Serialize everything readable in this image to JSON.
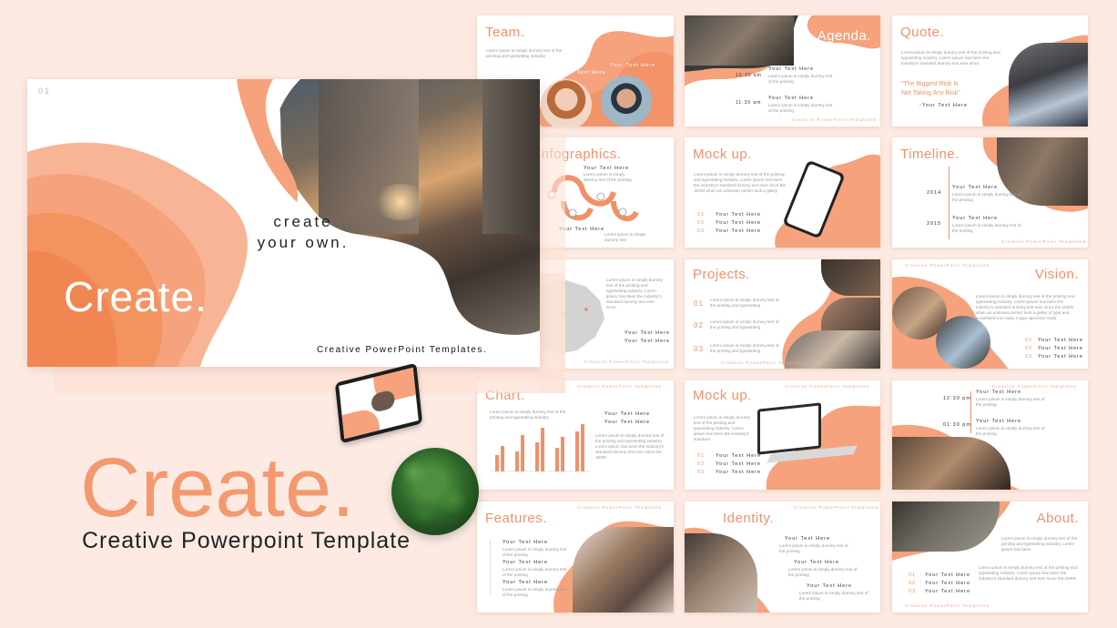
{
  "cover": {
    "page_number": "01",
    "tagline_line1": "create",
    "tagline_line2": "your own.",
    "title": "Create.",
    "footer": "Creative PowerPoint Templates."
  },
  "hero": {
    "title": "Create.",
    "subtitle": "Creative Powerpoint Template"
  },
  "slides": {
    "team": {
      "title": "Team.",
      "label1": "Your Text Here",
      "label2": "Your Text Here"
    },
    "agenda": {
      "title": "Agenda.",
      "time1": "10:30 am",
      "time2": "11:30 am",
      "label1": "Your Text Here",
      "label2": "Your Text Here",
      "footer": "Creative PowerPoint Templates"
    },
    "quote": {
      "title": "Quote.",
      "quote_line1": "\"The Biggest Risk Is",
      "quote_line2": "Not Taking Any Risk\"",
      "author": "-Your Text Here"
    },
    "infographics": {
      "title": "Infographics.",
      "label1": "Your Text Here",
      "label2": "Your Text Here"
    },
    "mockup1": {
      "title": "Mock up.",
      "items": [
        "Your Text Here",
        "Your Text Here",
        "Your Text Here"
      ],
      "nums": [
        "01",
        "02",
        "03"
      ]
    },
    "timeline": {
      "title": "Timeline.",
      "year1": "2014",
      "year2": "2015",
      "label1": "Your Text Here",
      "label2": "Your Text Here",
      "footer": "Creative PowerPoint Templates"
    },
    "map": {
      "label1": "Your Text Here",
      "label2": "Your Text Here",
      "footer": "Creative PowerPoint Templates"
    },
    "projects": {
      "title": "Projects.",
      "nums": [
        "01",
        "02",
        "03"
      ],
      "footer": "Creative PowerPoint Templates"
    },
    "vision": {
      "title": "Vision.",
      "items": [
        "Your Text Here",
        "Your Text Here",
        "Your Text Here"
      ],
      "nums": [
        "01",
        "02",
        "03"
      ],
      "header": "Creative PowerPoint Templates"
    },
    "chart": {
      "title": "Chart.",
      "label1": "Your Text Here",
      "label2": "Your Text Here",
      "header": "Creative PowerPoint Templates"
    },
    "mockup2": {
      "title": "Mock up.",
      "items": [
        "Your Text Here",
        "Your Text Here",
        "Your Text Here"
      ],
      "nums": [
        "01",
        "02",
        "03"
      ],
      "header": "Creative PowerPoint Templates"
    },
    "schedule": {
      "time1": "12:30 pm",
      "time2": "01:30 pm",
      "label1": "Your Text Here",
      "label2": "Your Text Here",
      "header": "Creative PowerPoint Templates"
    },
    "features": {
      "title": "Features.",
      "items": [
        "Your Text Here",
        "Your Text Here",
        "Your Text Here"
      ],
      "header": "Creative PowerPoint Templates"
    },
    "identity": {
      "title": "Identity.",
      "items": [
        "Your Text Here",
        "Your Text Here",
        "Your Text Here"
      ],
      "header": "Creative PowerPoint Templates"
    },
    "about": {
      "title": "About.",
      "items": [
        "Your Text Here",
        "Your Text Here",
        "Your Text Here"
      ],
      "nums": [
        "01",
        "02",
        "03"
      ],
      "footer": "Creative PowerPoint Templates"
    }
  },
  "colors": {
    "accent": "#f4996f",
    "accent_dark": "#e87f55",
    "background": "#fdebe3",
    "text": "#222222"
  }
}
